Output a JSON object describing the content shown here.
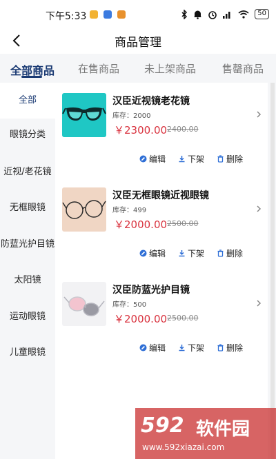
{
  "status_bar": {
    "time": "下午5:33",
    "battery": "50",
    "app_icons": [
      {
        "name": "app-icon-1",
        "color": "#f2b233"
      },
      {
        "name": "app-icon-2",
        "color": "#3b7be0"
      },
      {
        "name": "app-icon-3",
        "color": "#e8912d"
      }
    ]
  },
  "header": {
    "title": "商品管理"
  },
  "tabs": [
    {
      "label": "全部商品",
      "active": true
    },
    {
      "label": "在售商品",
      "active": false
    },
    {
      "label": "未上架商品",
      "active": false
    },
    {
      "label": "售罄商品",
      "active": false
    }
  ],
  "sidebar": {
    "items": [
      {
        "label": "全部",
        "active": true
      },
      {
        "label": "眼镜分类",
        "active": false
      },
      {
        "label": "近视/老花镜",
        "active": false
      },
      {
        "label": "无框眼镜",
        "active": false
      },
      {
        "label": "防蓝光护目镜",
        "active": false
      },
      {
        "label": "太阳镜",
        "active": false
      },
      {
        "label": "运动眼镜",
        "active": false
      },
      {
        "label": "儿童眼镜",
        "active": false
      }
    ]
  },
  "products": [
    {
      "name": "汉臣近视镜老花镜",
      "stock": "库存：2000",
      "price": "￥2300.00",
      "original_price": "2400.00",
      "thumb": "teal-glasses"
    },
    {
      "name": "汉臣无框眼镜近视眼镜",
      "stock": "库存：499",
      "price": "￥2000.00",
      "original_price": "2500.00",
      "thumb": "round-glasses"
    },
    {
      "name": "汉臣防蓝光护目镜",
      "stock": "库存：500",
      "price": "￥2000.00",
      "original_price": "2500.00",
      "thumb": "pink-glasses"
    }
  ],
  "actions": {
    "edit": "编辑",
    "unlist": "下架",
    "delete": "删除"
  },
  "watermark": {
    "number": "592",
    "text": "软件园",
    "url": "www.592xiazai.com"
  },
  "colors": {
    "accent": "#1a3a73",
    "price": "#d9333f",
    "action_icon": "#2f6fd6"
  }
}
